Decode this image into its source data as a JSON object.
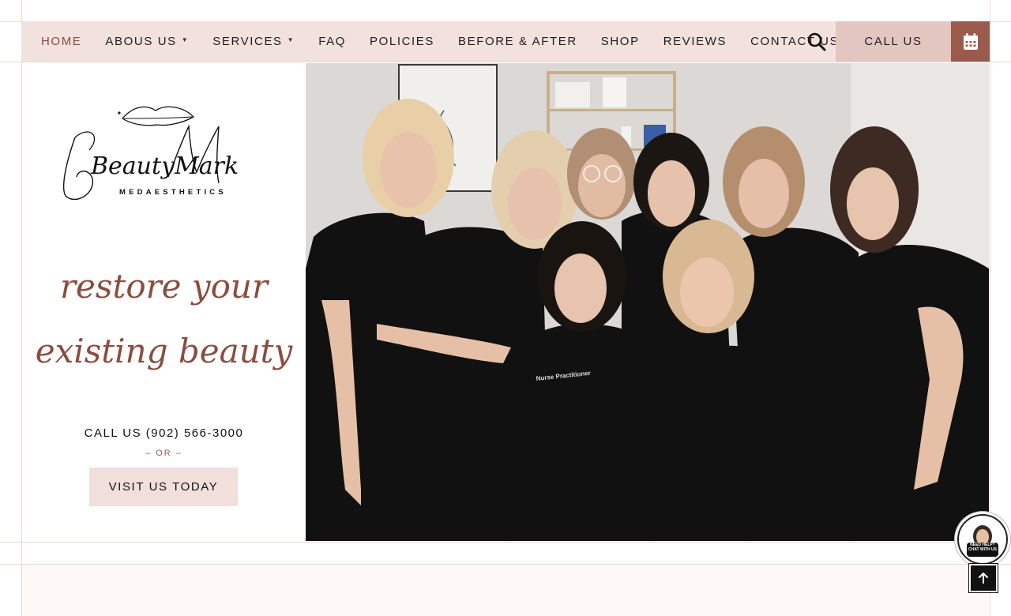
{
  "nav": {
    "items": [
      {
        "label": "HOME",
        "active": true,
        "dropdown": false
      },
      {
        "label": "ABOUS US",
        "active": false,
        "dropdown": true
      },
      {
        "label": "SERVICES",
        "active": false,
        "dropdown": true
      },
      {
        "label": "FAQ",
        "active": false,
        "dropdown": false
      },
      {
        "label": "POLICIES",
        "active": false,
        "dropdown": false
      },
      {
        "label": "BEFORE & AFTER",
        "active": false,
        "dropdown": false
      },
      {
        "label": "SHOP",
        "active": false,
        "dropdown": false
      },
      {
        "label": "REVIEWS",
        "active": false,
        "dropdown": false
      },
      {
        "label": "CONTACT US",
        "active": false,
        "dropdown": false
      }
    ],
    "search_icon": "search-icon",
    "call_label": "CALL US",
    "calendar_icon": "calendar-icon"
  },
  "hero": {
    "logo": {
      "script": "BeautyMark",
      "sub": "MEDAESTHETICS"
    },
    "tagline_line1": "restore your",
    "tagline_line2": "existing beauty",
    "phone": "CALL US (902) 566-3000",
    "or": "– OR –",
    "visit_button": "VISIT US TODAY",
    "photo_text": "Nurse Practitioner"
  },
  "chat": {
    "label_line1": "NEED HELP?",
    "label_line2": "CHAT WITH US"
  },
  "back_to_top_icon": "arrow-up-icon",
  "colors": {
    "accent": "#8a4d40",
    "nav_bg": "#f2e1dd",
    "call_bg": "#e4c6c1",
    "calendar_bg": "#9a5a4c",
    "visit_bg": "#f0dfdb"
  }
}
